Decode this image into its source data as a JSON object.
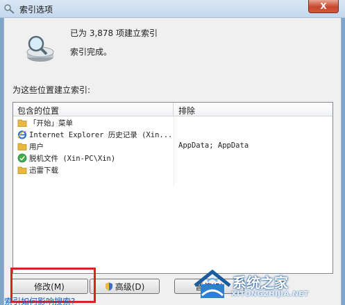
{
  "window": {
    "title": "索引选项",
    "close_label": "X"
  },
  "status": {
    "count_text": "已为 3,878 项建立索引",
    "state_text": "索引完成。"
  },
  "list": {
    "caption": "为这些位置建立索引:",
    "headers": {
      "included": "包含的位置",
      "excluded": "排除"
    },
    "rows": [
      {
        "icon": "folder-icon",
        "name": "「开始」菜单",
        "excluded": ""
      },
      {
        "icon": "ie-icon",
        "name": "Internet Explorer 历史记录 (Xin...",
        "excluded": ""
      },
      {
        "icon": "folder-icon",
        "name": "用户",
        "excluded": "AppData; AppData"
      },
      {
        "icon": "offline-files-icon",
        "name": "脱机文件 (Xin-PC\\Xin)",
        "excluded": ""
      },
      {
        "icon": "folder-icon",
        "name": "迅雷下载",
        "excluded": ""
      }
    ]
  },
  "buttons": {
    "modify": "修改(M)",
    "advanced": "高级(D)",
    "pause": "暂停(P)"
  },
  "links": {
    "help": "索引如何影响搜索?"
  },
  "watermark": {
    "brand": "系统之家",
    "domain": "XITONGZHIJIA.NET"
  },
  "colors": {
    "highlight": "#e02020",
    "link": "#1a5fb4",
    "folder": "#e8b93c"
  }
}
